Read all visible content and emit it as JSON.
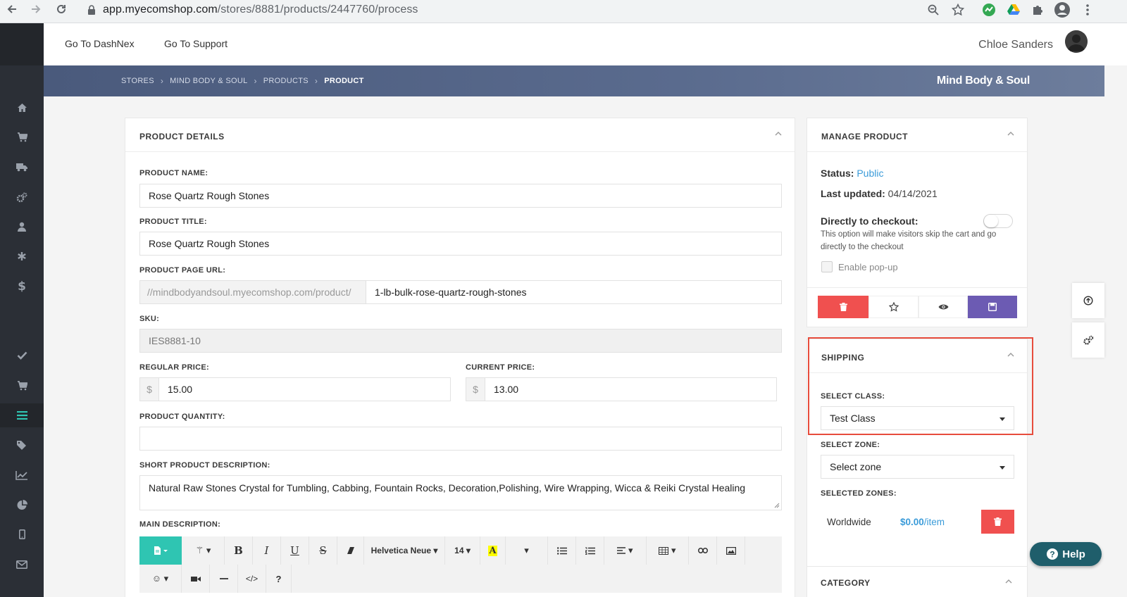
{
  "browser": {
    "url_host": "app.myecomshop.com",
    "url_path": "/stores/8881/products/2447760/process"
  },
  "topbar": {
    "links": [
      "Go To DashNex",
      "Go To Support"
    ],
    "user_name": "Chloe Sanders"
  },
  "breadcrumb": {
    "items": [
      "STORES",
      "MIND BODY & SOUL",
      "PRODUCTS",
      "PRODUCT"
    ],
    "store_title": "Mind Body & Soul"
  },
  "sidebar": {
    "icons": [
      "home-icon",
      "cart-icon",
      "truck-icon",
      "cogs-icon",
      "user-icon",
      "asterisk-icon",
      "dollar-icon",
      "check-icon",
      "shopping-cart-icon",
      "list-icon",
      "tags-icon",
      "line-chart-icon",
      "pie-chart-icon",
      "mobile-icon",
      "envelope-icon"
    ],
    "active": "list-icon"
  },
  "product_details": {
    "title": "PRODUCT DETAILS",
    "name_label": "PRODUCT NAME:",
    "name_value": "Rose Quartz Rough Stones",
    "title_label": "PRODUCT TITLE:",
    "title_value": "Rose Quartz Rough Stones",
    "url_label": "PRODUCT PAGE URL:",
    "url_prefix": "//mindbodyandsoul.myecomshop.com/product/",
    "url_slug": "1-lb-bulk-rose-quartz-rough-stones",
    "sku_label": "SKU:",
    "sku_value": "IES8881-10",
    "regular_price_label": "REGULAR PRICE:",
    "regular_price_value": "15.00",
    "current_price_label": "CURRENT PRICE:",
    "current_price_value": "13.00",
    "currency_symbol": "$",
    "quantity_label": "PRODUCT QUANTITY:",
    "quantity_value": "",
    "short_desc_label": "SHORT PRODUCT DESCRIPTION:",
    "short_desc_value": "Natural Raw Stones Crystal for Tumbling, Cabbing, Fountain Rocks, Decoration,Polishing, Wire Wrapping, Wicca & Reiki Crystal Healing",
    "main_desc_label": "MAIN DESCRIPTION:",
    "toolbar": {
      "font_family": "Helvetica Neue",
      "font_size": "14",
      "help": "?"
    }
  },
  "manage_product": {
    "title": "MANAGE PRODUCT",
    "status_label": "Status:",
    "status_value": "Public",
    "updated_label": "Last updated:",
    "updated_value": "04/14/2021",
    "checkout_label": "Directly to checkout:",
    "checkout_help": "This option will make visitors skip the cart and go directly to the checkout",
    "popup_label": "Enable pop-up",
    "colors": {
      "delete": "#f0504f",
      "save": "#6c5bb3"
    }
  },
  "shipping": {
    "title": "SHIPPING",
    "class_label": "SELECT CLASS:",
    "class_value": "Test Class",
    "zone_label": "SELECT ZONE:",
    "zone_value": "Select zone",
    "selected_zones_label": "SELECTED ZONES:",
    "zones": [
      {
        "name": "Worldwide",
        "price": "$0.00",
        "unit": "/item"
      }
    ],
    "highlight_color": "#e74c3c"
  },
  "category": {
    "title": "CATEGORY"
  },
  "help_button": {
    "label": "Help"
  }
}
